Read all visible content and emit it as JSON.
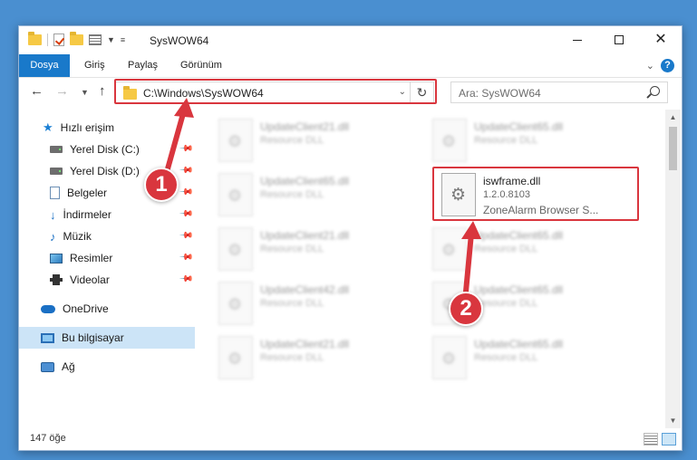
{
  "window": {
    "title": "SysWOW64",
    "controls": {
      "minimize": "—",
      "maximize": "☐",
      "close": "✕"
    }
  },
  "ribbon": {
    "tabs": [
      "Dosya",
      "Giriş",
      "Paylaş",
      "Görünüm"
    ],
    "help": "?"
  },
  "address": {
    "path": "C:\\Windows\\SysWOW64",
    "refresh_glyph": "↻"
  },
  "search": {
    "placeholder": "Ara: SysWOW64"
  },
  "sidebar": {
    "items": [
      {
        "label": "Hızlı erişim",
        "icon": "star-icon"
      },
      {
        "label": "Yerel Disk (C:)",
        "icon": "disk-icon",
        "pinned": true
      },
      {
        "label": "Yerel Disk (D:)",
        "icon": "disk-icon",
        "pinned": true
      },
      {
        "label": "Belgeler",
        "icon": "document-icon",
        "pinned": true
      },
      {
        "label": "İndirmeler",
        "icon": "download-icon",
        "pinned": true
      },
      {
        "label": "Müzik",
        "icon": "music-icon",
        "pinned": true
      },
      {
        "label": "Resimler",
        "icon": "pictures-icon",
        "pinned": true
      },
      {
        "label": "Videolar",
        "icon": "video-icon",
        "pinned": true
      },
      {
        "label": "OneDrive",
        "icon": "cloud-icon"
      },
      {
        "label": "Bu bilgisayar",
        "icon": "computer-icon",
        "selected": true
      },
      {
        "label": "Ağ",
        "icon": "network-icon"
      }
    ]
  },
  "files": {
    "left_column": [
      {
        "name": "UpdateClient21.dll",
        "desc": "Resource DLL"
      },
      {
        "name": "UpdateClient65.dll",
        "desc": "Resource DLL"
      },
      {
        "name": "UpdateClient21.dll",
        "desc": "Resource DLL"
      },
      {
        "name": "UpdateClient42.dll",
        "desc": "Resource DLL"
      },
      {
        "name": "UpdateClient21.dll",
        "desc": "Resource DLL"
      }
    ],
    "right_column": [
      {
        "name": "UpdateClient65.dll",
        "desc": "Resource DLL"
      },
      {
        "name": "UpdateClient65.dll",
        "desc": "Resource DLL"
      },
      {
        "name": "UpdateClient65.dll",
        "desc": "Resource DLL"
      },
      {
        "name": "UpdateClient65.dll",
        "desc": "Resource DLL"
      }
    ],
    "highlighted": {
      "name": "iswframe.dll",
      "version": "1.2.0.8103",
      "desc": "ZoneAlarm Browser S..."
    }
  },
  "status": {
    "item_count": "147 öğe"
  },
  "annotations": {
    "step1": "1",
    "step2": "2",
    "color": "#d9363e"
  }
}
